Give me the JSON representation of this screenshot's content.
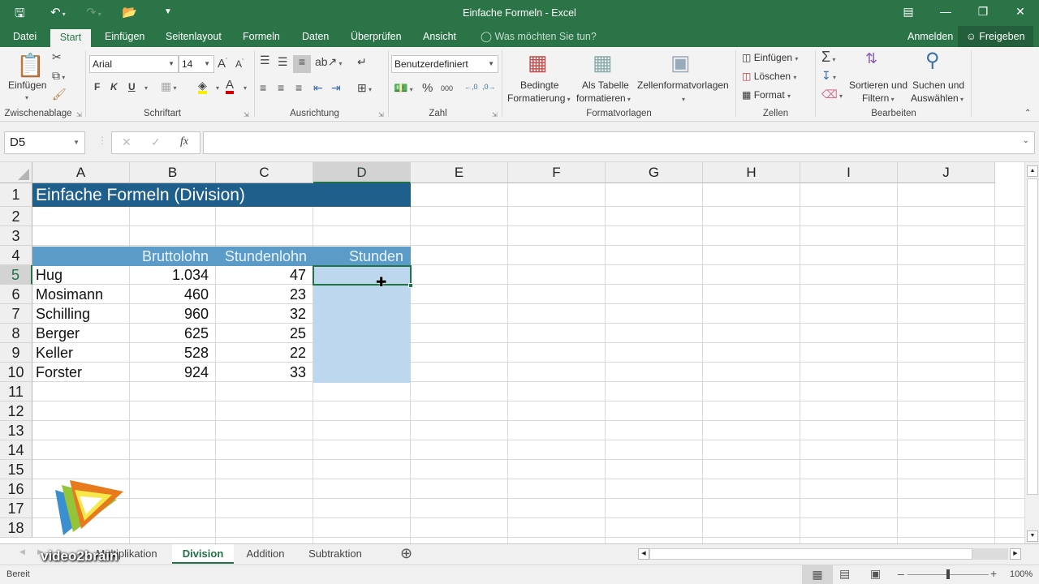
{
  "window": {
    "title": "Einfache Formeln - Excel",
    "controls": [
      "ribbon-display-options",
      "minimize",
      "restore",
      "close"
    ]
  },
  "quick_access": [
    "save",
    "undo",
    "redo",
    "open",
    "customize"
  ],
  "ribbon_tabs": [
    {
      "label": "Datei",
      "active": false
    },
    {
      "label": "Start",
      "active": true
    },
    {
      "label": "Einfügen",
      "active": false
    },
    {
      "label": "Seitenlayout",
      "active": false
    },
    {
      "label": "Formeln",
      "active": false
    },
    {
      "label": "Daten",
      "active": false
    },
    {
      "label": "Überprüfen",
      "active": false
    },
    {
      "label": "Ansicht",
      "active": false
    }
  ],
  "tell_me": "Was möchten Sie tun?",
  "account": {
    "signin": "Anmelden",
    "share": "Freigeben"
  },
  "ribbon": {
    "clipboard": {
      "label": "Zwischenablage",
      "paste": "Einfügen"
    },
    "font": {
      "label": "Schriftart",
      "family": "Arial",
      "size": "14",
      "bold": "F",
      "italic": "K",
      "underline": "U"
    },
    "alignment": {
      "label": "Ausrichtung"
    },
    "number": {
      "label": "Zahl",
      "format": "Benutzerdefiniert",
      "percent": "%",
      "thousands": "000"
    },
    "styles": {
      "label": "Formatvorlagen",
      "conditional": [
        "Bedingte",
        "Formatierung"
      ],
      "as_table": [
        "Als Tabelle",
        "formatieren"
      ],
      "cell_styles": "Zellenformatvorlagen"
    },
    "cells": {
      "label": "Zellen",
      "insert": "Einfügen",
      "delete": "Löschen",
      "format": "Format"
    },
    "editing": {
      "label": "Bearbeiten",
      "sort": [
        "Sortieren und",
        "Filtern"
      ],
      "find": [
        "Suchen und",
        "Auswählen"
      ]
    }
  },
  "formula_bar": {
    "name_box": "D5",
    "formula": "",
    "fx": "fx"
  },
  "columns": [
    "A",
    "B",
    "C",
    "D",
    "E",
    "F",
    "G",
    "H",
    "I",
    "J"
  ],
  "selected_column": "D",
  "rows": [
    "1",
    "2",
    "3",
    "4",
    "5",
    "6",
    "7",
    "8",
    "9",
    "10",
    "11",
    "12",
    "13",
    "14",
    "15",
    "16",
    "17",
    "18"
  ],
  "selected_row": "5",
  "sheet": {
    "title": "Einfache Formeln (Division)",
    "headers": {
      "B": "Bruttolohn",
      "C": "Stundenlohn",
      "D": "Stunden"
    },
    "data": [
      {
        "name": "Hug",
        "brutto": "1.034",
        "stundenlohn": "47",
        "stunden": ""
      },
      {
        "name": "Mosimann",
        "brutto": "460",
        "stundenlohn": "23",
        "stunden": ""
      },
      {
        "name": "Schilling",
        "brutto": "960",
        "stundenlohn": "32",
        "stunden": ""
      },
      {
        "name": "Berger",
        "brutto": "625",
        "stundenlohn": "25",
        "stunden": ""
      },
      {
        "name": "Keller",
        "brutto": "528",
        "stundenlohn": "22",
        "stunden": ""
      },
      {
        "name": "Forster",
        "brutto": "924",
        "stundenlohn": "33",
        "stunden": ""
      }
    ]
  },
  "sheet_tabs": [
    {
      "label": "Multiplikation",
      "active": false
    },
    {
      "label": "Division",
      "active": true
    },
    {
      "label": "Addition",
      "active": false
    },
    {
      "label": "Subtraktion",
      "active": false
    }
  ],
  "status": {
    "ready": "Bereit",
    "zoom": "100%",
    "zoom_fraction": 0.5
  },
  "watermark": "video2brain",
  "colors": {
    "accent": "#217346",
    "title_fill": "#1f5f8b",
    "header_fill": "#5b9bc8",
    "selection_fill": "#bdd7ee"
  }
}
